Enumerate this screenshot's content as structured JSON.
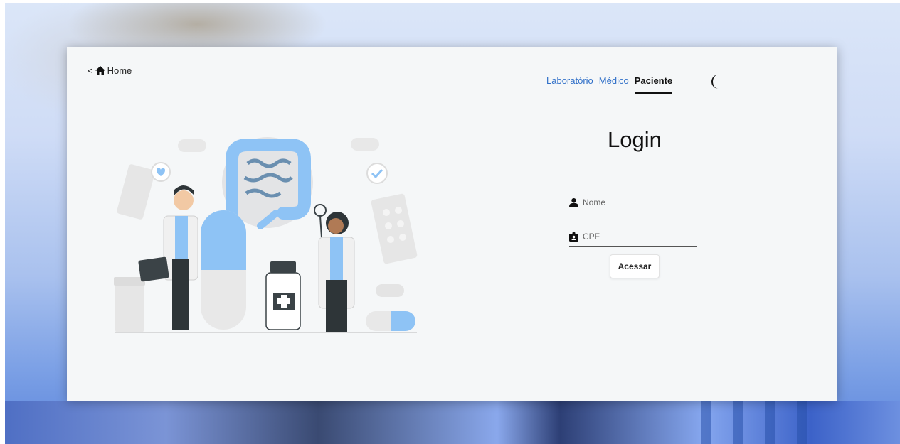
{
  "nav": {
    "back_prefix": "<",
    "home_label": "Home"
  },
  "tabs": [
    {
      "label": "Laboratório",
      "active": false
    },
    {
      "label": "Médico",
      "active": false
    },
    {
      "label": "Paciente",
      "active": true
    }
  ],
  "theme_toggle_icon": "moon-icon",
  "login": {
    "title": "Login",
    "name_placeholder": "Nome",
    "cpf_placeholder": "CPF",
    "submit_label": "Acessar"
  },
  "colors": {
    "accent_link": "#2f6fc8",
    "card_bg": "#f5f7f8",
    "illustration_blue": "#8ec3f5"
  }
}
